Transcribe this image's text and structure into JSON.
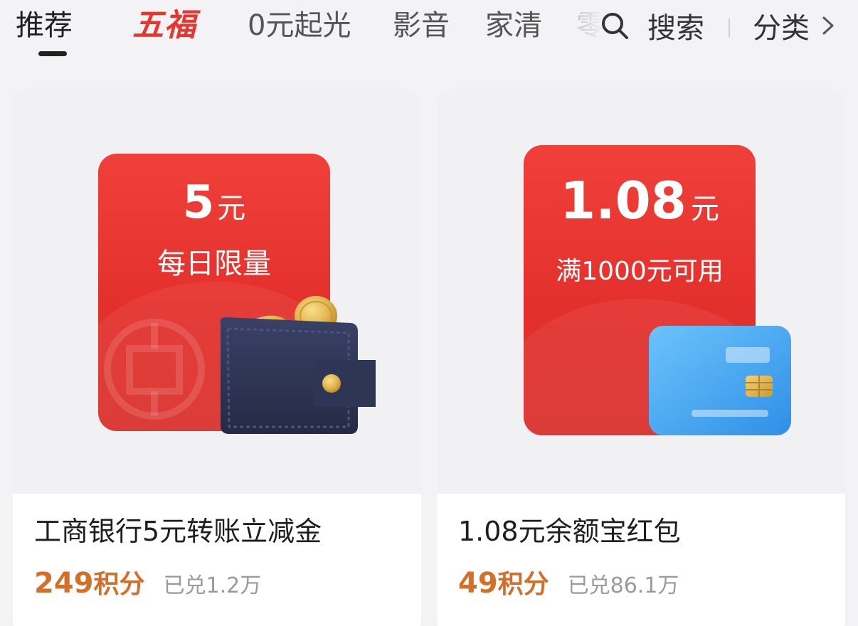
{
  "tabs": {
    "recommend": "推荐",
    "wufu": "五福",
    "zero_yuan": "0元起光",
    "media": "影音",
    "home_cleaning": "家清",
    "snacks": "零"
  },
  "search": {
    "label": "搜索",
    "icon": "search-icon"
  },
  "category": {
    "label": "分类",
    "icon": "chevron-right-icon"
  },
  "colors": {
    "brand_red": "#e8362c",
    "coupon_red": "#e4302c",
    "points_orange": "#d2702a",
    "wallet_navy": "#2f3554",
    "card_blue": "#3aa0ef"
  },
  "products": [
    {
      "coupon_amount": "5",
      "coupon_unit": "元",
      "coupon_desc": "每日限量",
      "title": "工商银行5元转账立减金",
      "points": "249",
      "points_unit": "积分",
      "redeemed": "已兑1.2万",
      "illustration": "wallet-with-coins"
    },
    {
      "coupon_amount": "1.08",
      "coupon_unit": "元",
      "coupon_desc": "满1000元可用",
      "title": "1.08元余额宝红包",
      "points": "49",
      "points_unit": "积分",
      "redeemed": "已兑86.1万",
      "illustration": "bank-card"
    }
  ]
}
